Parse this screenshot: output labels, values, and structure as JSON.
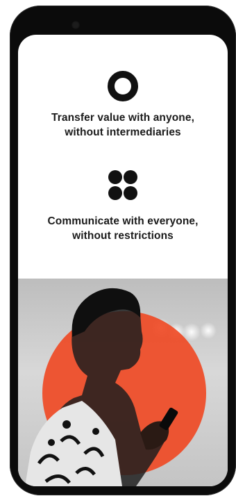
{
  "features": [
    {
      "icon": "ring-icon",
      "line1": "Transfer value with anyone,",
      "line2": "without intermediaries"
    },
    {
      "icon": "four-dots-icon",
      "line1": "Communicate with everyone,",
      "line2": "without restrictions"
    }
  ],
  "colors": {
    "accent": "#ef4a25",
    "text": "#1b1b1b",
    "device": "#0b0b0b",
    "screen": "#ffffff"
  }
}
